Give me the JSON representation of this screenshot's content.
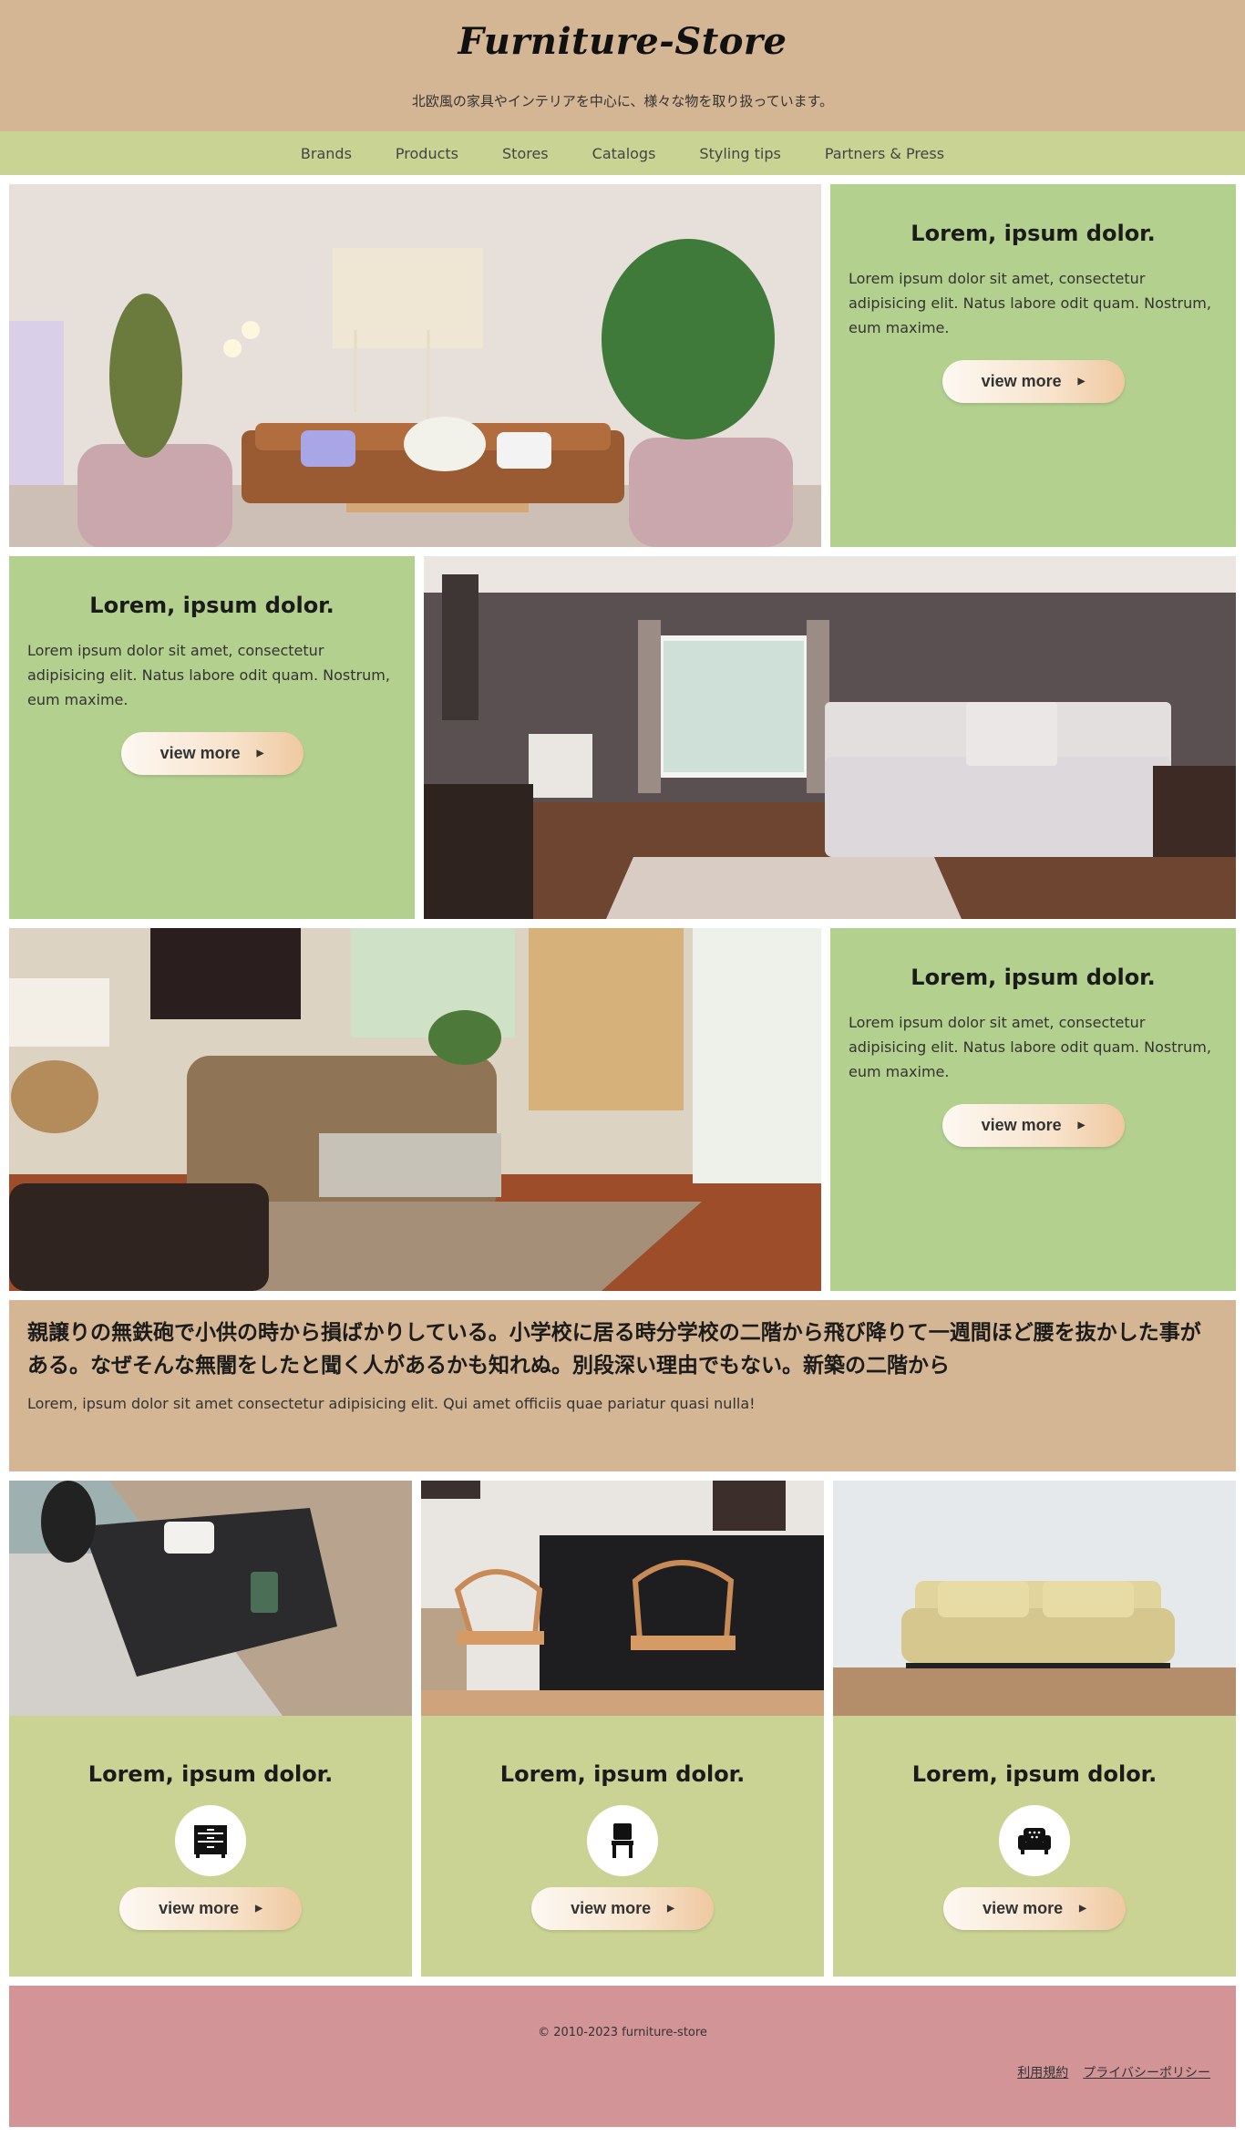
{
  "header": {
    "logo": "Furniture-Store",
    "tagline": "北欧風の家具やインテリアを中心に、様々な物を取り扱っています。"
  },
  "nav": [
    "Brands",
    "Products",
    "Stores",
    "Catalogs",
    "Styling tips",
    "Partners & Press"
  ],
  "features": [
    {
      "title": "Lorem, ipsum dolor.",
      "body": "Lorem ipsum dolor sit amet, consectetur adipisicing elit. Natus labore odit quam. Nostrum, eum maxime.",
      "button": "view more"
    },
    {
      "title": "Lorem, ipsum dolor.",
      "body": "Lorem ipsum dolor sit amet, consectetur adipisicing elit. Natus labore odit quam. Nostrum, eum maxime.",
      "button": "view more"
    },
    {
      "title": "Lorem, ipsum dolor.",
      "body": "Lorem ipsum dolor sit amet, consectetur adipisicing elit. Natus labore odit quam. Nostrum, eum maxime.",
      "button": "view more"
    }
  ],
  "article": {
    "heading": "親譲りの無鉄砲で小供の時から損ばかりしている。小学校に居る時分学校の二階から飛び降りて一週間ほど腰を抜かした事がある。なぜそんな無闇をしたと聞く人があるかも知れぬ。別段深い理由でもない。新築の二階から",
    "body": "Lorem, ipsum dolor sit amet consectetur adipisicing elit. Qui amet officiis quae pariatur quasi nulla!"
  },
  "cards": [
    {
      "title": "Lorem, ipsum dolor.",
      "icon": "dresser-icon",
      "button": "view more"
    },
    {
      "title": "Lorem, ipsum dolor.",
      "icon": "chair-icon",
      "button": "view more"
    },
    {
      "title": "Lorem, ipsum dolor.",
      "icon": "armchair-icon",
      "button": "view more"
    }
  ],
  "footer": {
    "copyright": "© 2010-2023 furniture-store",
    "links": [
      "利用規約",
      "プライバシーポリシー"
    ]
  },
  "colors": {
    "header_bg": "#d4b594",
    "nav_bg": "#c9d394",
    "feature_panel_bg": "#b4d08f",
    "card_bg": "#cbd394",
    "footer_bg": "#d39498"
  }
}
